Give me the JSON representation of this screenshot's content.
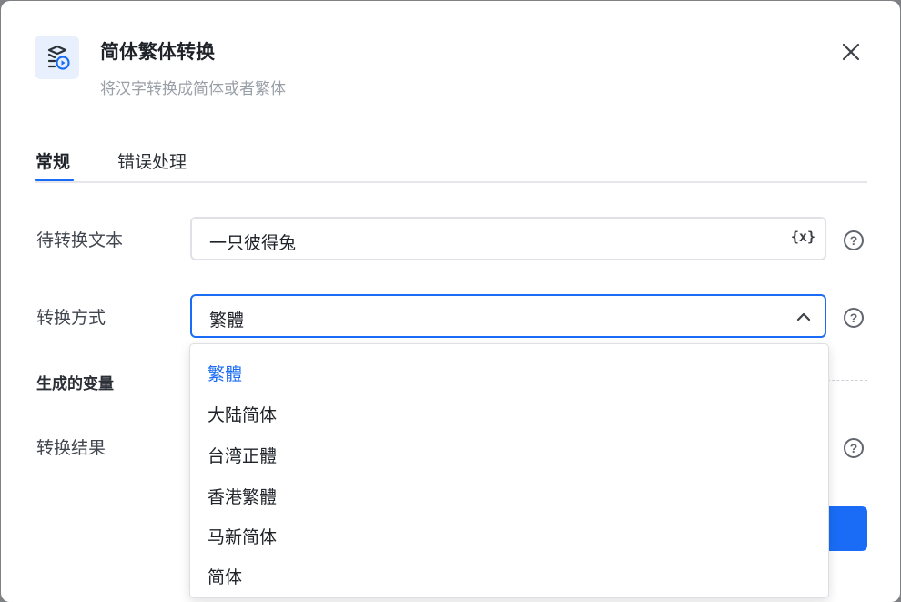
{
  "header": {
    "title": "简体繁体转换",
    "subtitle": "将汉字转换成简体或者繁体"
  },
  "tabs": [
    {
      "label": "常规"
    },
    {
      "label": "错误处理"
    }
  ],
  "fields": {
    "source_text": {
      "label": "待转换文本",
      "value": "一只彼得兔",
      "var_button": "{x}"
    },
    "mode": {
      "label": "转换方式",
      "value": "繁體"
    }
  },
  "section": {
    "title": "生成的变量"
  },
  "result": {
    "label": "转换结果"
  },
  "help_glyph": "?",
  "dropdown": {
    "options": [
      "繁體",
      "大陆简体",
      "台湾正體",
      "香港繁體",
      "马新简体",
      "简体"
    ],
    "selected": "繁體"
  },
  "colors": {
    "accent": "#1a6cf6",
    "overlay": "#7f8083"
  }
}
